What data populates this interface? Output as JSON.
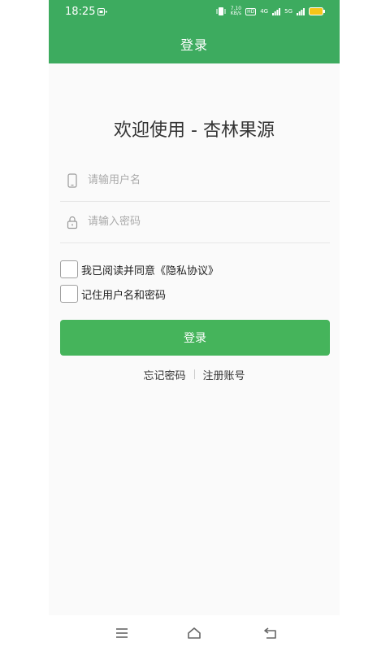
{
  "status_bar": {
    "time": "18:25",
    "net_speed_value": "7.10",
    "net_speed_unit": "KB/s",
    "hd_label": "HD",
    "network_4g": "4G",
    "network_5g": "5G"
  },
  "header": {
    "title": "登录"
  },
  "welcome": {
    "text": "欢迎使用 - 杏林果源"
  },
  "form": {
    "username": {
      "placeholder": "请输用户名",
      "value": ""
    },
    "password": {
      "placeholder": "请输入密码",
      "value": ""
    },
    "privacy_checkbox_label": "我已阅读并同意《隐私协议》",
    "remember_checkbox_label": "记住用户名和密码",
    "login_button_label": "登录"
  },
  "links": {
    "forgot_password": "忘记密码",
    "register": "注册账号"
  },
  "colors": {
    "primary": "#3dab5f",
    "button": "#45b45b"
  },
  "icons": {
    "username": "phone-icon",
    "password": "lock-icon",
    "nav_menu": "menu-icon",
    "nav_home": "home-icon",
    "nav_back": "back-icon"
  }
}
